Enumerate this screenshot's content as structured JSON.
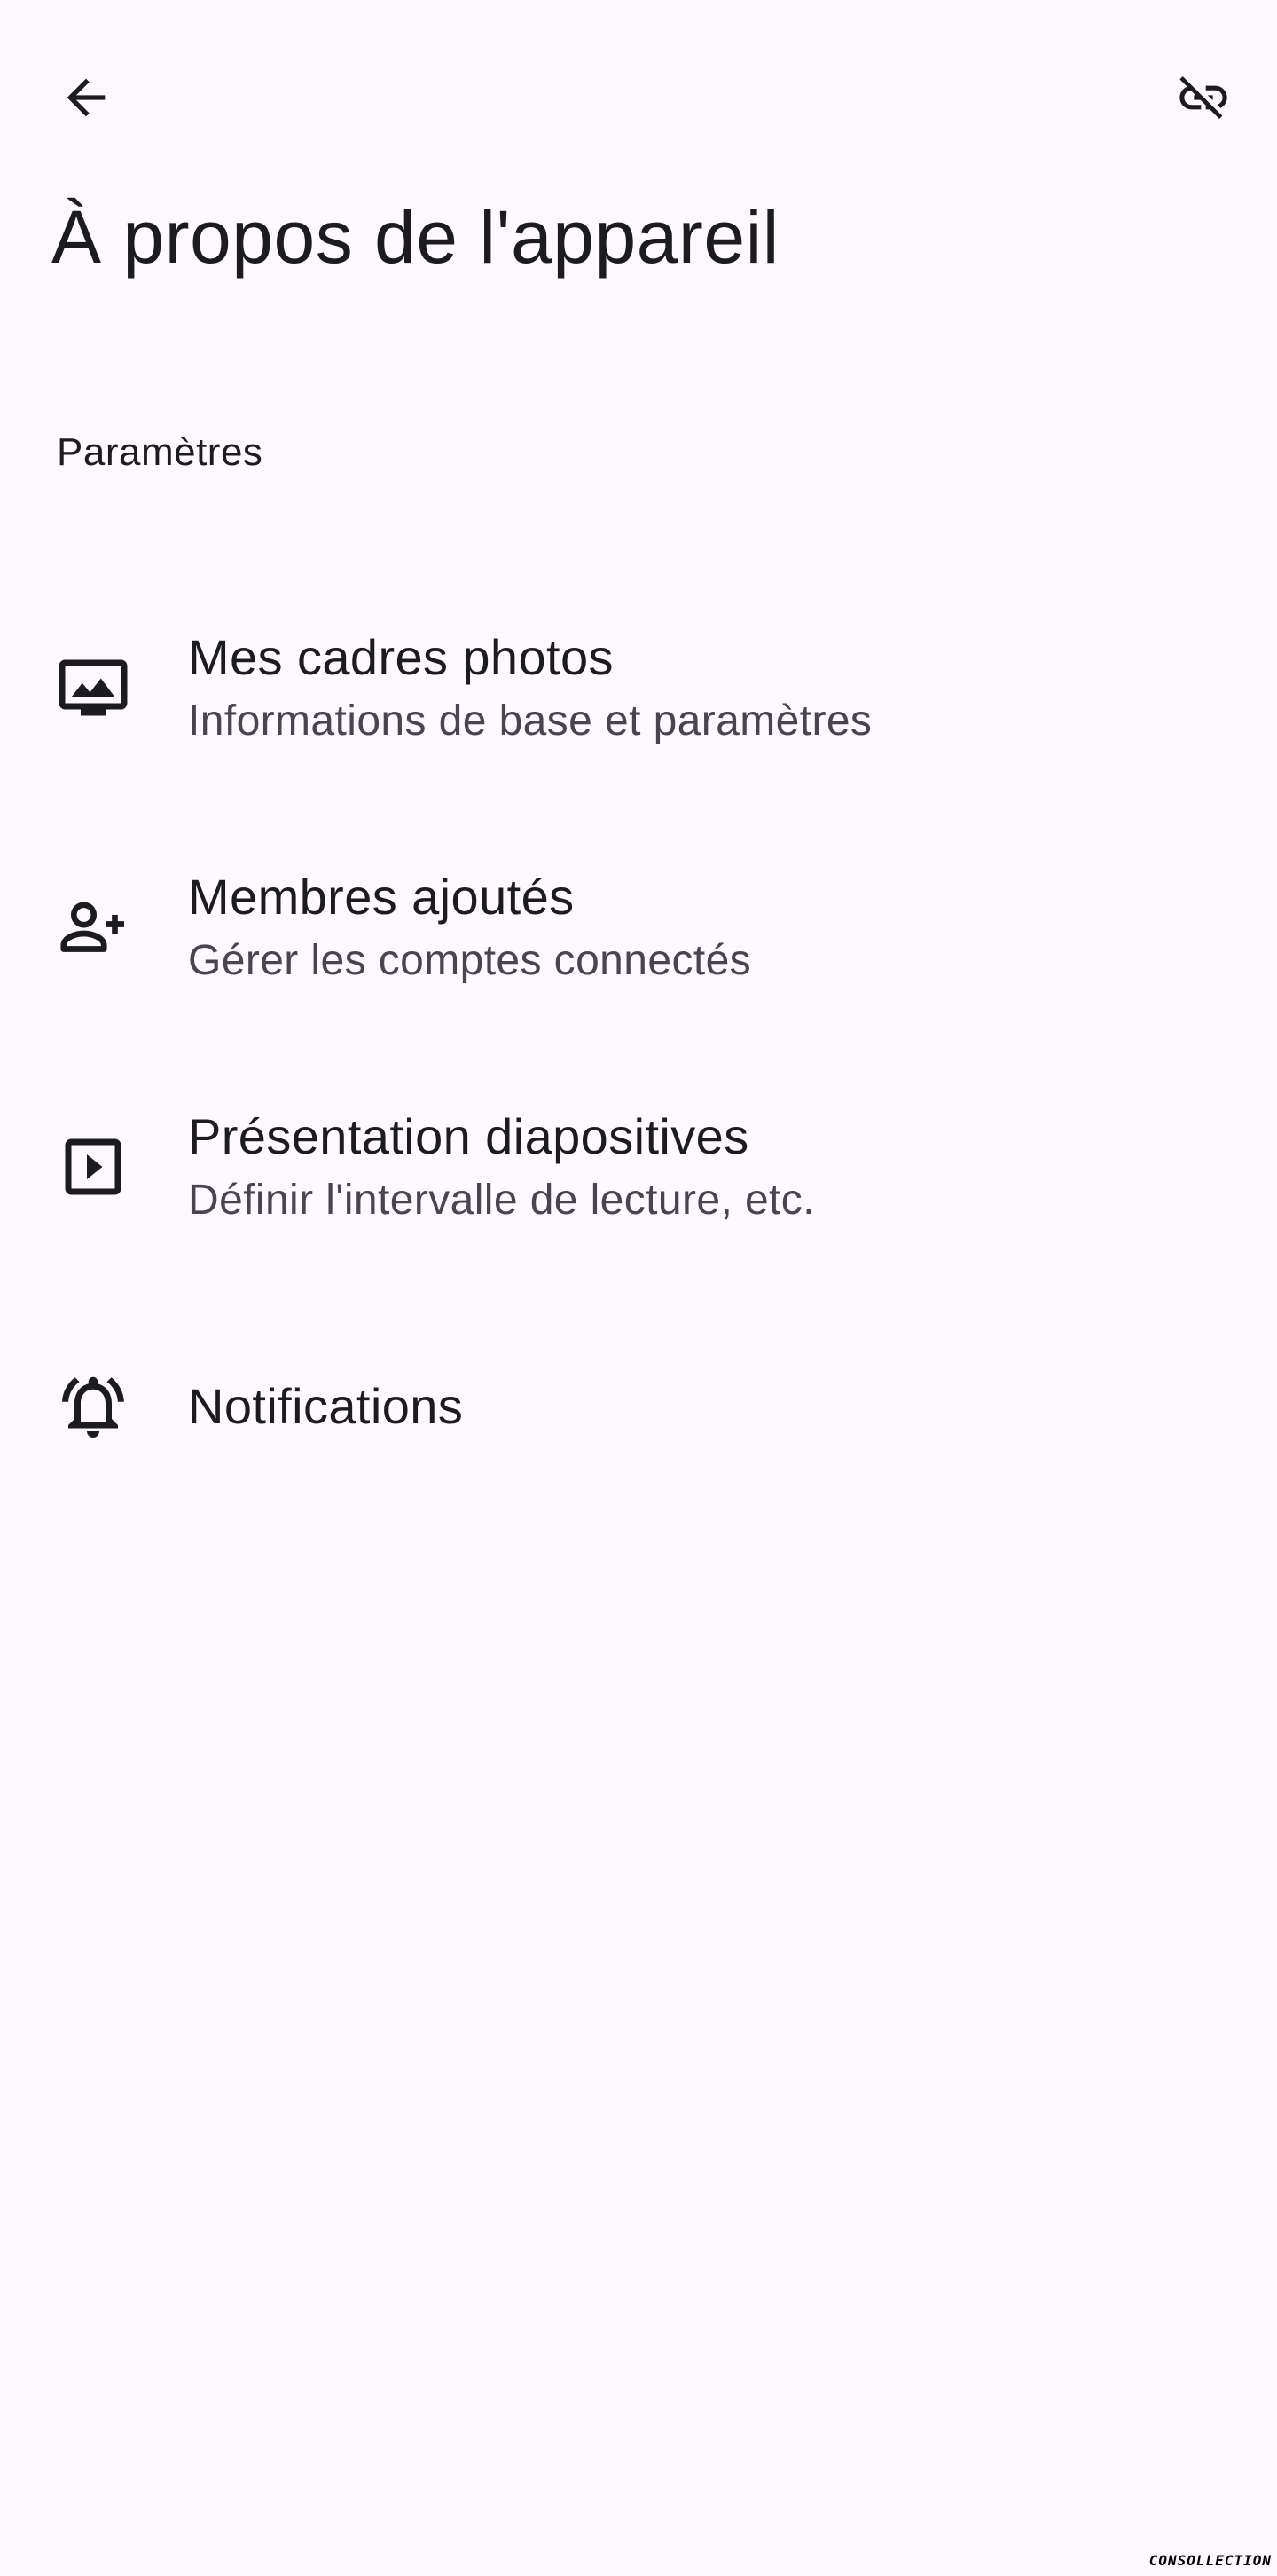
{
  "header": {
    "title": "À propos de l'appareil",
    "back_icon": "arrow-back-icon",
    "action_icon": "link-off-icon"
  },
  "section": {
    "label": "Paramètres"
  },
  "items": [
    {
      "icon": "photo-frame-icon",
      "title": "Mes cadres photos",
      "subtitle": "Informations de base et paramètres"
    },
    {
      "icon": "person-add-icon",
      "title": "Membres ajoutés",
      "subtitle": "Gérer les comptes connectés"
    },
    {
      "icon": "slideshow-icon",
      "title": "Présentation diapositives",
      "subtitle": "Définir l'intervalle de lecture, etc."
    },
    {
      "icon": "notification-bell-icon",
      "title": "Notifications",
      "subtitle": ""
    }
  ],
  "watermark": "CONSOLLECTION",
  "colors": {
    "background": "#FDF8FD",
    "on_surface": "#1C1B1F",
    "on_surface_variant": "#49454F"
  }
}
